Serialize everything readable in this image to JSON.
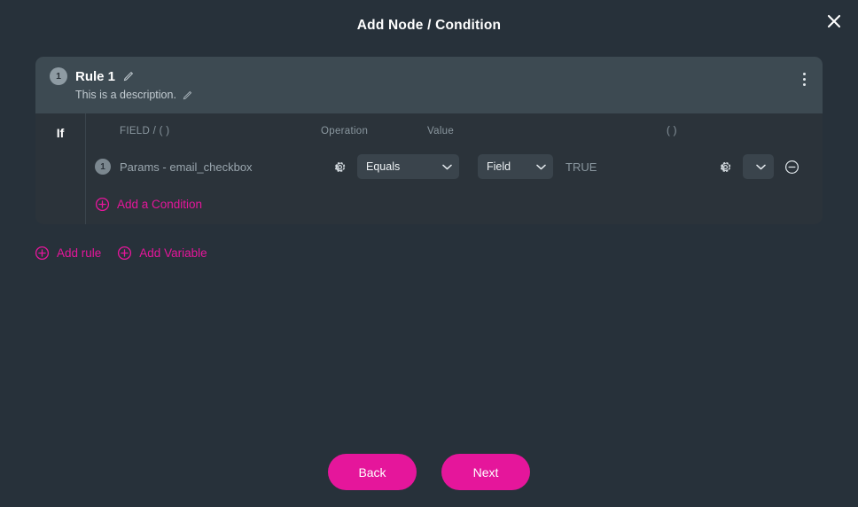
{
  "dialog": {
    "title": "Add Node / Condition",
    "close_icon": "close-icon"
  },
  "rule": {
    "badge": "1",
    "name": "Rule 1",
    "name_edit_icon": "pencil-icon",
    "description": "This is a description.",
    "description_edit_icon": "pencil-icon",
    "menu_icon": "kebab-menu-icon"
  },
  "logic": {
    "if_label": "If"
  },
  "columns": {
    "field": "FIELD / ( )",
    "operation": "Operation",
    "value": "Value",
    "paren": "( )"
  },
  "condition": {
    "badge": "1",
    "field": "Params - email_checkbox",
    "field_settings_icon": "gear-icon",
    "operation": "Equals",
    "value_type": "Field",
    "value": "TRUE",
    "value_settings_icon": "gear-icon",
    "paren_value": "",
    "remove_icon": "minus-circle-icon"
  },
  "actions": {
    "add_condition": "Add a Condition",
    "add_rule": "Add rule",
    "add_variable": "Add Variable",
    "add_icon": "plus-circle-icon"
  },
  "footer": {
    "back": "Back",
    "next": "Next"
  },
  "colors": {
    "accent": "#e5169b",
    "background": "#27313a",
    "panel": "#2b333a",
    "panel_header": "#3d4a52",
    "control": "#3a444c"
  }
}
